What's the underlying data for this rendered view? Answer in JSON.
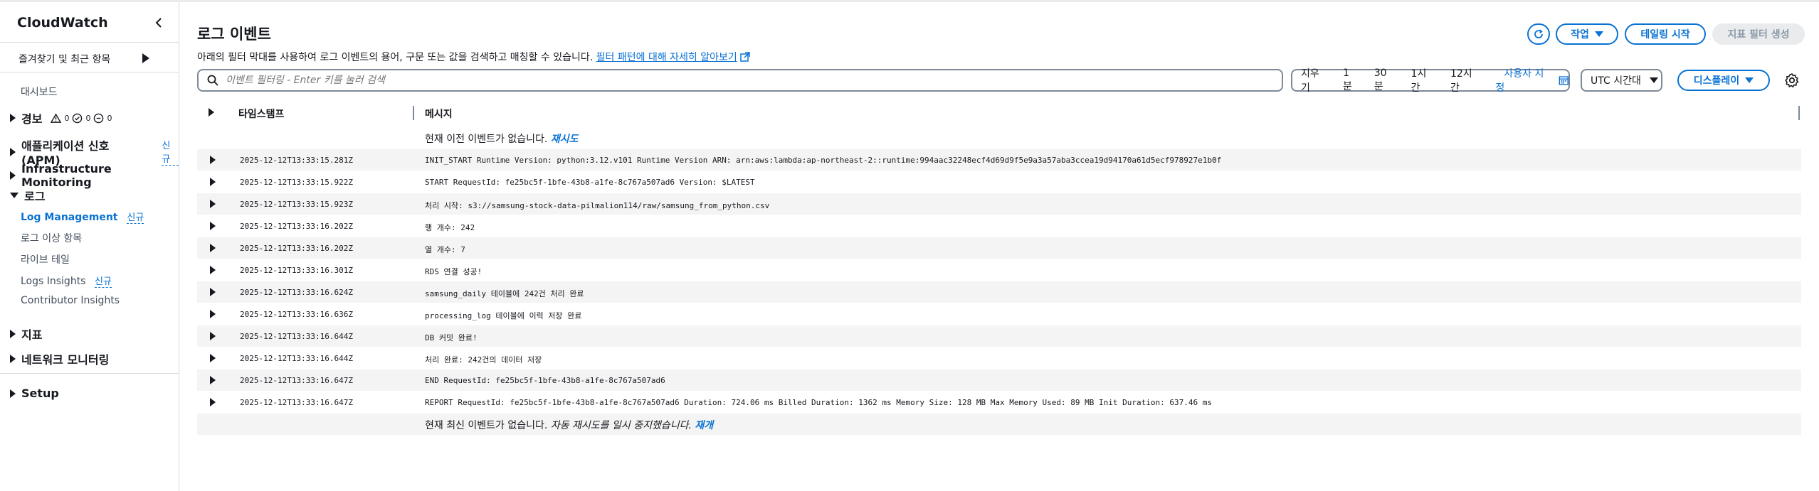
{
  "sidebar": {
    "title": "CloudWatch",
    "favorites": "즐겨찾기 및 최근 항목",
    "dashboard": "대시보드",
    "alarms": {
      "label": "경보",
      "in_alarm": "0",
      "ok": "0",
      "insufficient": "0"
    },
    "apm": {
      "label": "애플리케이션 신호 (APM)",
      "badge": "신규"
    },
    "infra": "Infrastructure Monitoring",
    "logs": {
      "label": "로그",
      "items": [
        {
          "label": "Log Management",
          "badge": "신규"
        },
        {
          "label": "로그 이상 항목"
        },
        {
          "label": "라이브 테일"
        },
        {
          "label": "Logs Insights",
          "badge": "신규"
        },
        {
          "label": "Contributor Insights"
        }
      ]
    },
    "metrics": "지표",
    "network": "네트워크 모니터링",
    "setup": "Setup"
  },
  "header": {
    "title": "로그 이벤트",
    "description": "아래의 필터 막대를 사용하여 로그 이벤트의 용어, 구문 또는 값을 검색하고 매칭할 수 있습니다.",
    "learn_more": "필터 패턴에 대해 자세히 알아보기",
    "actions_label": "작업",
    "tail_label": "테일링 시작",
    "metric_filter_label": "지표 필터 생성"
  },
  "filter": {
    "placeholder": "이벤트 필터링 - Enter 키를 눌러 검색",
    "clear": "지우기",
    "ranges": [
      "1분",
      "30분",
      "1시간",
      "12시간"
    ],
    "custom": "사용자 지정",
    "timezone": "UTC 시간대",
    "display": "디스플레이"
  },
  "table": {
    "col_timestamp": "타임스탬프",
    "col_message": "메시지",
    "top_notice": "현재 이전 이벤트가 없습니다.",
    "retry": "재시도",
    "bottom_notice": "현재 최신 이벤트가 없습니다.",
    "bottom_paused": "자동 재시도를 일시 중지했습니다.",
    "resume": "재개",
    "rows": [
      {
        "ts": "2025-12-12T13:33:15.281Z",
        "msg": "INIT_START Runtime Version: python:3.12.v101 Runtime Version ARN: arn:aws:lambda:ap-northeast-2::runtime:994aac32248ecf4d69d9f5e9a3a57aba3ccea19d94170a61d5ecf978927e1b0f"
      },
      {
        "ts": "2025-12-12T13:33:15.922Z",
        "msg": "START RequestId: fe25bc5f-1bfe-43b8-a1fe-8c767a507ad6 Version: $LATEST"
      },
      {
        "ts": "2025-12-12T13:33:15.923Z",
        "msg": "처리 시작: s3://samsung-stock-data-pilmalion114/raw/samsung_from_python.csv"
      },
      {
        "ts": "2025-12-12T13:33:16.202Z",
        "msg": "행 개수: 242"
      },
      {
        "ts": "2025-12-12T13:33:16.202Z",
        "msg": "열 개수: 7"
      },
      {
        "ts": "2025-12-12T13:33:16.301Z",
        "msg": "RDS 연결 성공!"
      },
      {
        "ts": "2025-12-12T13:33:16.624Z",
        "msg": "samsung_daily 테이블에 242건 처리 완료"
      },
      {
        "ts": "2025-12-12T13:33:16.636Z",
        "msg": "processing_log 테이블에 이력 저장 완료"
      },
      {
        "ts": "2025-12-12T13:33:16.644Z",
        "msg": "DB 커밋 완료!"
      },
      {
        "ts": "2025-12-12T13:33:16.644Z",
        "msg": "처리 완료: 242건의 데이터 저장"
      },
      {
        "ts": "2025-12-12T13:33:16.647Z",
        "msg": "END RequestId: fe25bc5f-1bfe-43b8-a1fe-8c767a507ad6"
      },
      {
        "ts": "2025-12-12T13:33:16.647Z",
        "msg": "REPORT RequestId: fe25bc5f-1bfe-43b8-a1fe-8c767a507ad6 Duration: 724.06 ms Billed Duration: 1362 ms Memory Size: 128 MB Max Memory Used: 89 MB Init Duration: 637.46 ms"
      }
    ]
  },
  "colors": {
    "accent": "#0972d3",
    "text": "#16191f",
    "row_alt": "#f4f4f4"
  }
}
